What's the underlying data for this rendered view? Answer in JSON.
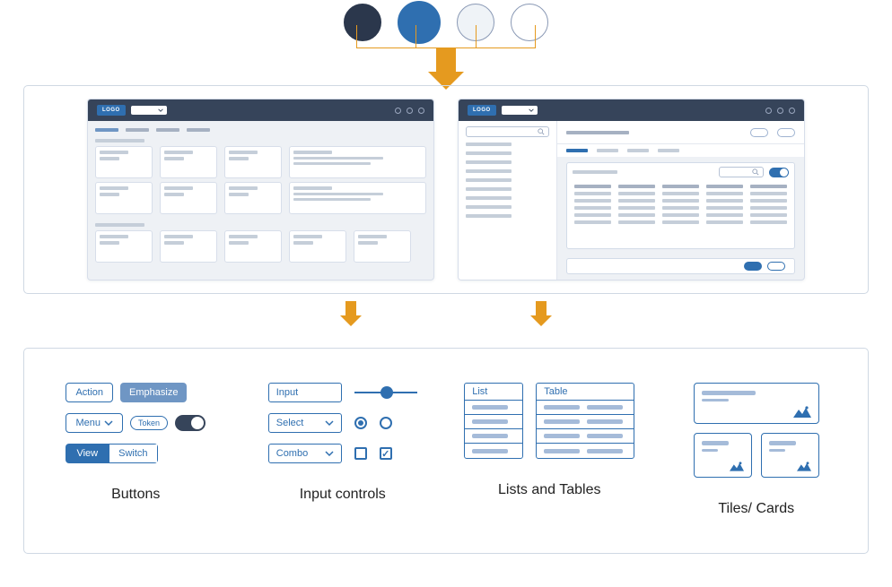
{
  "palette": {
    "dark": "#2b374c",
    "blue": "#2f6fb0",
    "light": "#eff3f7",
    "white": "#ffffff",
    "accent": "#e59a1f"
  },
  "mock": {
    "logo": "LOGO"
  },
  "buttons": {
    "action": "Action",
    "emphasize": "Emphasize",
    "menu": "Menu",
    "token": "Token",
    "view": "View",
    "switch": "Switch"
  },
  "inputs": {
    "input": "Input",
    "select": "Select",
    "combo": "Combo"
  },
  "listsTables": {
    "list": "List",
    "table": "Table"
  },
  "sections": {
    "buttons": "Buttons",
    "inputControls": "Input controls",
    "listsTables": "Lists and Tables",
    "tilesCards": "Tiles/ Cards"
  }
}
